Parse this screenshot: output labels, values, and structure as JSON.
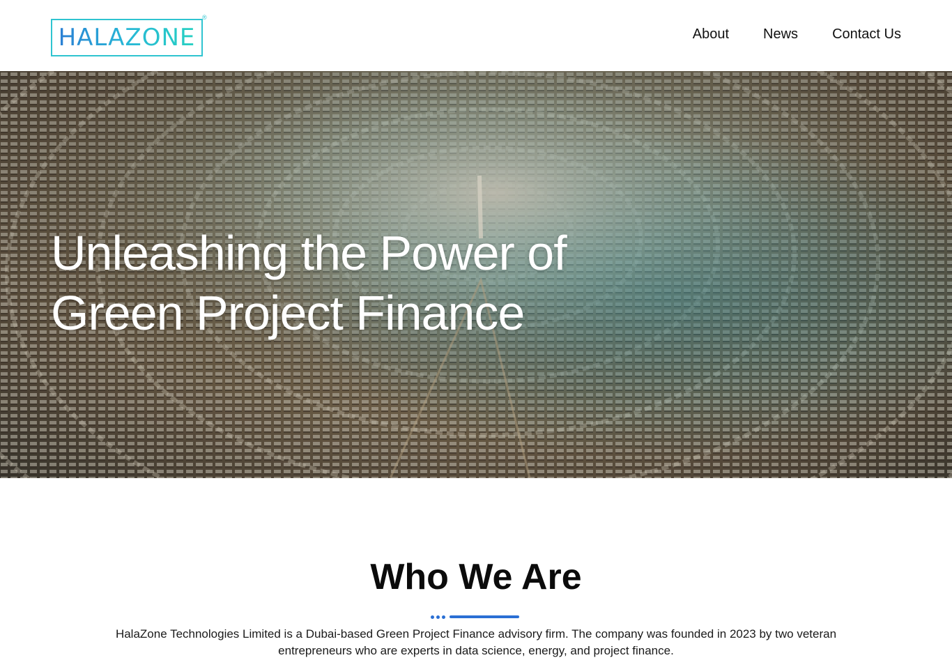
{
  "header": {
    "logo_text": "HALAZONE",
    "logo_mark": "®",
    "nav": [
      "About",
      "News",
      "Contact Us"
    ]
  },
  "hero": {
    "title_line1": "Unleashing the Power of",
    "title_line2": "Green Project Finance"
  },
  "who_we_are": {
    "title": "Who We Are",
    "description": "HalaZone Technologies Limited is a Dubai-based Green Project Finance advisory firm. The company was founded in 2023 by two veteran entrepreneurs who are experts in data science, energy, and project finance."
  },
  "colors": {
    "accent": "#2a6fd4",
    "logo_teal": "#2fc4d0"
  }
}
